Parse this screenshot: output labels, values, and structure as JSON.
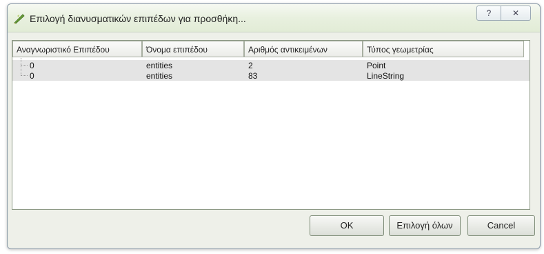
{
  "window": {
    "title": "Επιλογή διανυσματικών επιπέδων για προσθήκη...",
    "help_glyph": "?",
    "close_glyph": "✕"
  },
  "table": {
    "columns": [
      "Αναγνωριστικό Επιπέδου",
      "Όνομα επιπέδου",
      "Αριθμός αντικειμένων",
      "Τύπος γεωμετρίας"
    ],
    "rows": [
      {
        "id": "0",
        "name": "entities",
        "count": "2",
        "geometry": "Point"
      },
      {
        "id": "0",
        "name": "entities",
        "count": "83",
        "geometry": "LineString"
      }
    ]
  },
  "buttons": {
    "ok": "OK",
    "select_all": "Επιλογή όλων",
    "cancel": "Cancel"
  },
  "colors": {
    "selection": "#e4e4e4",
    "titlebar": "#e4efdc",
    "body": "#eef0e9"
  }
}
